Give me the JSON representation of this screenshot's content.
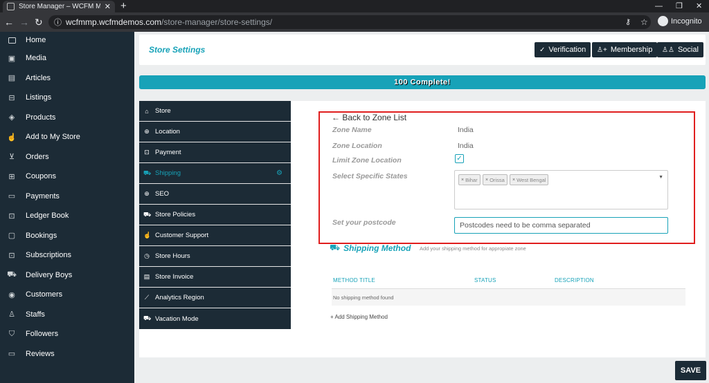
{
  "browser": {
    "tab_title": "Store Manager – WCFM Marketp",
    "tab_close": "✕",
    "new_tab": "+",
    "url_domain": "wcfmmp.wcfmdemos.com",
    "url_path": "/store-manager/store-settings/",
    "profile": "Incognito"
  },
  "sidebar": {
    "items": [
      {
        "label": "Home",
        "icon": "monitor-icon"
      },
      {
        "label": "Media",
        "icon": "image-icon"
      },
      {
        "label": "Articles",
        "icon": "document-icon"
      },
      {
        "label": "Listings",
        "icon": "briefcase-icon"
      },
      {
        "label": "Products",
        "icon": "cube-icon"
      },
      {
        "label": "Add to My Store",
        "icon": "hand-pointer-icon"
      },
      {
        "label": "Orders",
        "icon": "cart-icon"
      },
      {
        "label": "Coupons",
        "icon": "gift-icon"
      },
      {
        "label": "Payments",
        "icon": "credit-card-icon"
      },
      {
        "label": "Ledger Book",
        "icon": "money-icon"
      },
      {
        "label": "Bookings",
        "icon": "calendar-icon"
      },
      {
        "label": "Subscriptions",
        "icon": "money-icon"
      },
      {
        "label": "Delivery Boys",
        "icon": "truck-icon"
      },
      {
        "label": "Customers",
        "icon": "user-circle-icon"
      },
      {
        "label": "Staffs",
        "icon": "user-icon"
      },
      {
        "label": "Followers",
        "icon": "shirt-icon"
      },
      {
        "label": "Reviews",
        "icon": "comment-icon"
      }
    ]
  },
  "header": {
    "title": "Store Settings",
    "verification": "Verification",
    "membership": "Membership",
    "social": "Social"
  },
  "progress": {
    "label": "100 Complete!",
    "percent": 100
  },
  "settings_tabs": [
    {
      "label": "Store",
      "icon": "store-icon"
    },
    {
      "label": "Location",
      "icon": "globe-icon"
    },
    {
      "label": "Payment",
      "icon": "money-icon"
    },
    {
      "label": "Shipping",
      "icon": "truck-icon",
      "active": true
    },
    {
      "label": "SEO",
      "icon": "globe-icon"
    },
    {
      "label": "Store Policies",
      "icon": "truck-icon"
    },
    {
      "label": "Customer Support",
      "icon": "thumbs-up-icon"
    },
    {
      "label": "Store Hours",
      "icon": "clock-icon"
    },
    {
      "label": "Store Invoice",
      "icon": "invoice-icon"
    },
    {
      "label": "Analytics Region",
      "icon": "chart-icon"
    },
    {
      "label": "Vacation Mode",
      "icon": "vacation-icon"
    }
  ],
  "zone": {
    "back": "← Back to Zone List",
    "name_label": "Zone Name",
    "name_value": "India",
    "location_label": "Zone Location",
    "location_value": "India",
    "limit_label": "Limit Zone Location",
    "limit_checked": true,
    "states_label": "Select Specific States",
    "states": [
      "Bihar",
      "Orissa",
      "West Bengal"
    ],
    "postcode_label": "Set your postcode",
    "postcode_placeholder": "Postcodes need to be comma separated"
  },
  "shipping": {
    "title": "Shipping Method",
    "hint": "Add your shipping method for appropiate zone",
    "col_title": "METHOD TITLE",
    "col_status": "STATUS",
    "col_description": "DESCRIPTION",
    "empty": "No shipping method found",
    "add": "+ Add Shipping Method"
  },
  "save": "SAVE",
  "colors": {
    "accent": "#17a2b8",
    "dark": "#1c2b36",
    "highlight_border": "#e01e1e"
  }
}
